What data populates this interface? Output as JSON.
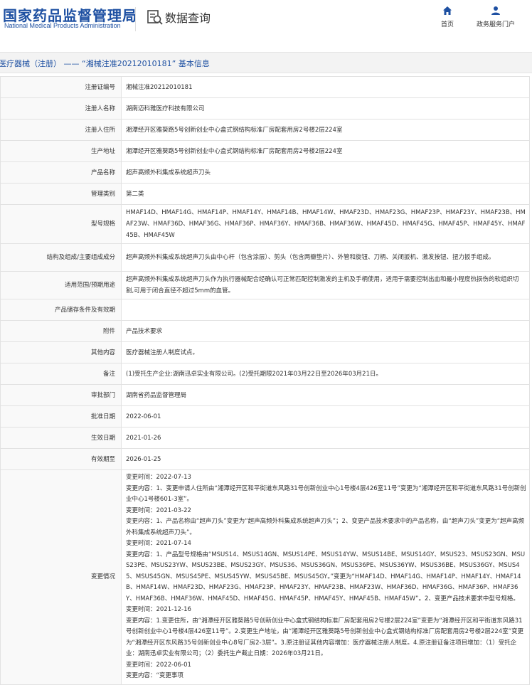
{
  "header": {
    "logo_cn": "国家药品监督管理局",
    "logo_en": "National Medical Products Administration",
    "search_title": "数据查询",
    "nav_home": "首页",
    "nav_service": "政务服务门户"
  },
  "title_bar": "医疗器械（注册） —— “湘械注准20212010181” 基本信息",
  "rows": {
    "reg_no": {
      "label": "注册证编号",
      "value": "湘械注准20212010181"
    },
    "registrant": {
      "label": "注册人名称",
      "value": "湖南迈科雅医疗科技有限公司"
    },
    "registrant_addr": {
      "label": "注册人住所",
      "value": "湘潭经开区雅葵路5号创新创业中心盒式钢结构标准厂房配套用房2号楼2层224室"
    },
    "prod_addr": {
      "label": "生产地址",
      "value": "湘潭经开区雅葵路5号创新创业中心盒式钢结构标准厂房配套用房2号楼2层224室"
    },
    "product_name": {
      "label": "产品名称",
      "value": "超声高频外科集成系统超声刀头"
    },
    "mgmt_class": {
      "label": "管理类别",
      "value": "第二类"
    },
    "model": {
      "label": "型号规格",
      "value": "HMAF14D、HMAF14G、HMAF14P、HMAF14Y、HMAF14B、HMAF14W、HMAF23D、HMAF23G、HMAF23P、HMAF23Y、HMAF23B、HMAF23W、HMAF36D、HMAF36G、HMAF36P、HMAF36Y、HMAF36B、HMAF36W、HMAF45D、HMAF45G、HMAF45P、HMAF45Y、HMAF45B、HMAF45W"
    },
    "structure": {
      "label": "结构及组成/主要组成成分",
      "value": "超声高频外科集成系统超声刀头由中心杆（包含涂层）、剪头（包含两瓣垫片）、外管和旋钮、刀柄、关闭扳机、激发按钮、扭力扳手组成。"
    },
    "scope": {
      "label": "适用范围/预期用途",
      "value": "超声高频外科集成系统超声刀头作为执行器械配合经确认可正常匹配控制激发的主机及手柄使用，适用于需要控制出血和最小程度热损伤的软组织切割,可用于闭合直径不超过5mm的血管。"
    },
    "storage": {
      "label": "产品储存条件及有效期",
      "value": ""
    },
    "attachment": {
      "label": "附件",
      "value": "产品技术要求"
    },
    "other": {
      "label": "其他内容",
      "value": "医疗器械注册人制度试点。"
    },
    "remarks": {
      "label": "备注",
      "value": "(1)受托生产企业:湖南迅卓实业有限公司。(2)受托期限2021年03月22日至2026年03月21日。"
    },
    "dept": {
      "label": "审批部门",
      "value": "湖南省药品监督管理局"
    },
    "approve_date": {
      "label": "批准日期",
      "value": "2022-06-01"
    },
    "effective_date": {
      "label": "生效日期",
      "value": "2021-01-26"
    },
    "expiry": {
      "label": "有效期至",
      "value": "2026-01-25"
    }
  },
  "changes": {
    "label": "变更情况",
    "lines": [
      "变更时间：2022-07-13",
      "变更内容：1、变更申请人住所由“湘潭经开区和平街道东风路31号创新创业中心1号楼4层426室11号”变更为“湘潭经开区和平街道东风路31号创新创业中心1号楼601-3室”。",
      "变更时间：2021-03-22",
      "变更内容：1、产品名称由“超声刀头”变更为“超声高频外科集成系统超声刀头”；2、变更产品技术要求中的产品名称，由“超声刀头”变更为“超声高频外科集成系统超声刀头”。",
      "变更时间：2021-07-14",
      "变更内容：1、产品型号规格由“MSUS14、MSUS14GN、MSUS14PE、MSUS14YW、MSUS14BE、MSUS14GY、MSUS23、MSUS23GN、MSUS23PE、MSUS23YW、MSUS23BE、MSUS23GY、MSUS36、MSUS36GN、MSUS36PE、MSUS36YW、MSUS36BE、MSUS36GY、MSUS45、MSUS45GN、MSUS45PE、MSUS45YW、MSUS45BE、MSUS45GY。”变更为“HMAF14D、HMAF14G、HMAF14P、HMAF14Y、HMAF14B、HMAF14W、HMAF23D、HMAF23G、HMAF23P、HMAF23Y、HMAF23B、HMAF23W、HMAF36D、HMAF36G、HMAF36P、HMAF36Y、HMAF36B、HMAF36W、HMAF45D、HMAF45G、HMAF45P、HMAF45Y、HMAF45B、HMAF45W”。2、变更产品技术要求中型号规格。",
      "变更时间：2021-12-16",
      "变更内容：1.变更住所，由“湘潭经开区雅葵路5号创新创业中心盒式钢结构标准厂房配套用房2号楼2层224室”变更为“湘潭经开区和平街道东风路31号创新创业中心1号楼4层426室11号”。2.变更生产地址，由“湘潭经开区雅葵路5号创新创业中心盒式钢结构标准厂房配套用房2号楼2层224室”变更为“湘潭经开区东风路35号创新创业中心8号厂房2-3层”。3.原注册证其他内容增加：医疗器械注册人制度。4.原注册证备注项目增加：（1）受托企业：湖南迅卓实业有限公司；（2）委托生产截止日期：2026年03月21日。",
      "变更时间：2022-06-01",
      "变更内容：“变更事项"
    ]
  }
}
